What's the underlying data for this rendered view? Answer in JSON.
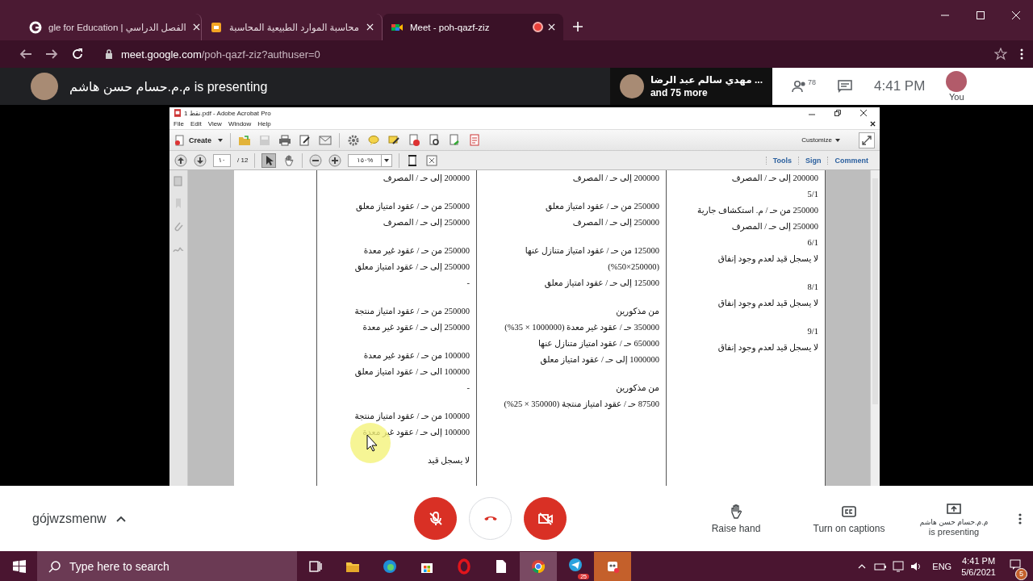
{
  "browser": {
    "tabs": [
      {
        "title": "Meet - poh-qazf-ziz",
        "kind": "meet",
        "selected": true,
        "recording": true
      },
      {
        "title": "محاسبة الموارد الطبيعية المحاسبة",
        "kind": "slides",
        "selected": false,
        "recording": false
      },
      {
        "title": "gle for Education | الفصل الدراسي",
        "kind": "google",
        "selected": false,
        "recording": false
      }
    ],
    "url_host": "meet.google.com",
    "url_path": "/poh-qazf-ziz?authuser=0"
  },
  "meet": {
    "presenter": "م.م.حسام حسن هاشم",
    "presenting_label": "is presenting",
    "participant_name": "مهدي سالم عبد الرضا ...",
    "more": "and 75 more",
    "people_count": "78",
    "time": "4:41 PM",
    "you_label": "You"
  },
  "acrobat": {
    "title": "نقط 1.pdf - Adobe Acrobat Pro",
    "menu": [
      "Help",
      "Window",
      "View",
      "Edit",
      "File"
    ],
    "create": "Create",
    "customize": "Customize",
    "page": "١٠",
    "page_total": "/ 12",
    "zoom": "١٥٠%",
    "panels": [
      "Comment",
      "Sign",
      "Tools"
    ]
  },
  "document": {
    "columns": [
      {
        "entries": [
          {
            "lines": [
              "200000 إلى حـ / المصرف",
              "5/1",
              "250000 من حـ / م. استكشاف جارية",
              "250000 إلى حـ / المصرف",
              "6/1",
              "لا يسجل قيد لعدم وجود إنفاق"
            ]
          },
          {
            "lines": [
              "8/1",
              "لا يسجل قيد لعدم وجود إنفاق"
            ]
          },
          {
            "lines": [
              "9/1",
              "لا يسجل قيد لعدم وجود إنفاق"
            ]
          }
        ]
      },
      {
        "entries": [
          {
            "lines": [
              "200000 إلى حـ / المصرف"
            ]
          },
          {
            "lines": [
              "250000 من حـ / عقود امتياز معلق",
              "250000 إلى حـ / المصرف"
            ]
          },
          {
            "lines": [
              "125000 من حـ / عقود امتياز متنازل عنها",
              "(%50×250000)",
              "125000 إلى حـ / عقود امتياز معلق"
            ]
          },
          {
            "lines": [
              "من مذكورين",
              "350000 حـ / عقود غير معدة (1000000 × 35%)",
              "650000 حـ / عقود امتياز متنازل عنها",
              "1000000 إلى حـ /  عقود امتياز معلق"
            ]
          },
          {
            "lines": [
              "من مذكورين",
              "87500 حـ / عقود امتياز منتجة (350000 × 25%)"
            ]
          }
        ]
      },
      {
        "entries": [
          {
            "lines": [
              "200000 إلى حـ / المصرف"
            ]
          },
          {
            "lines": [
              "250000 من حـ / عقود امتياز معلق",
              "250000 إلى حـ / المصرف"
            ]
          },
          {
            "lines": [
              "250000 من حـ / عقود غير معدة",
              "250000 إلى حـ / عقود امتياز معلق",
              "-"
            ]
          },
          {
            "lines": [
              "250000 من حـ / عقود امتياز منتجة",
              "250000 إلى حـ / عقود غير معدة"
            ]
          },
          {
            "lines": [
              "100000 من حـ / عقود غير معدة",
              "100000 الى حـ / عقود امتياز معلق",
              "-"
            ]
          },
          {
            "lines": [
              "100000 من حـ / عقود امتياز منتجة",
              "100000 إلى حـ / عقود غير معدة"
            ]
          },
          {
            "lines": [
              "لا يسجل قيد"
            ]
          }
        ]
      }
    ]
  },
  "call_bar": {
    "meeting_code": "gójwzsmenw",
    "mic_on": false,
    "camera_on": false,
    "raise_hand": "Raise hand",
    "captions": "Turn on captions",
    "presenter": "م.م.حسام حسن هاشم",
    "presenting": "is presenting"
  },
  "taskbar": {
    "search_placeholder": "Type here to search",
    "telegram_badge": "25",
    "language": "ENG",
    "time": "4:41 PM",
    "date": "5/6/2021",
    "notifications": "5"
  }
}
